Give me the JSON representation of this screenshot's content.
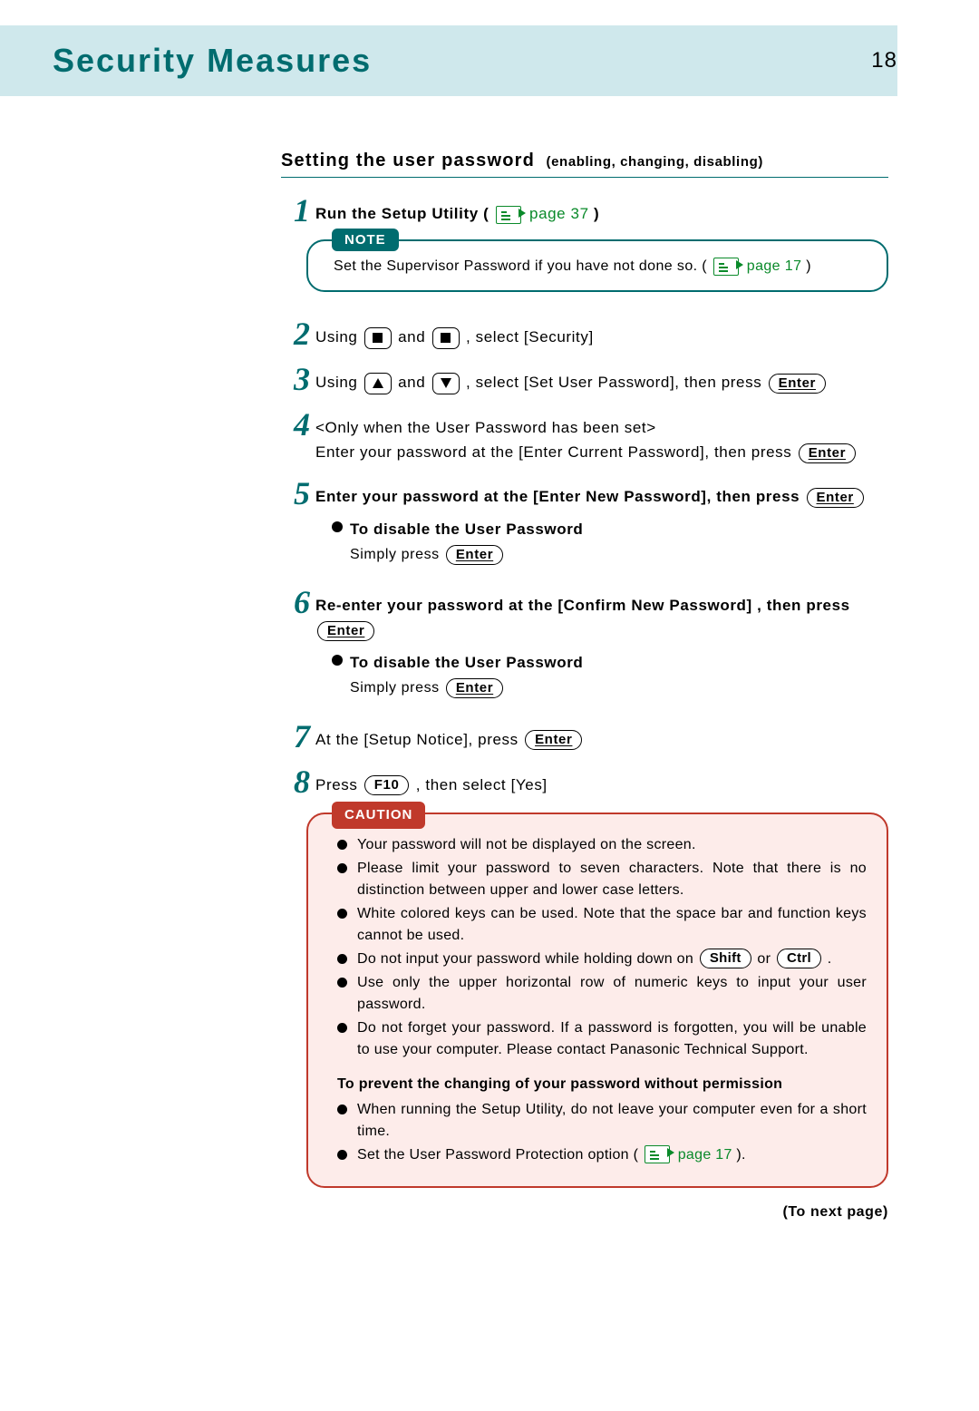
{
  "header": {
    "title": "Security Measures",
    "page_number": "18"
  },
  "section": {
    "title": "Setting the user password",
    "subtitle": "(enabling, changing, disabling)"
  },
  "steps": {
    "s1": {
      "num": "1",
      "text_a": "Run the Setup Utility  (",
      "page_ref": "page 37",
      "text_b": ")"
    },
    "note": {
      "label": "NOTE",
      "text_a": "Set the Supervisor Password if you have not done so. (",
      "page_ref": "page 17",
      "text_b": ")"
    },
    "s2": {
      "num": "2",
      "pre": "Using",
      "mid": "and",
      "post": ", select [Security]"
    },
    "s3": {
      "num": "3",
      "pre": "Using",
      "mid": "and",
      "post1": ", select [Set User Password], then press",
      "key": "Enter"
    },
    "s4": {
      "num": "4",
      "line1": "<Only when the User Password has been set>",
      "line2a": "Enter your password at the [Enter Current Password], then press",
      "key": "Enter"
    },
    "s5": {
      "num": "5",
      "line1a": "Enter your password at the [Enter New Password], then press",
      "key": "Enter",
      "disable_head": "To disable the User Password",
      "disable_text": "Simply press",
      "disable_key": "Enter"
    },
    "s6": {
      "num": "6",
      "line1a": "Re-enter your password at the [Confirm New Password] , then press",
      "key": "Enter",
      "disable_head": "To disable the User Password",
      "disable_text": "Simply press",
      "disable_key": "Enter"
    },
    "s7": {
      "num": "7",
      "text": "At the [Setup Notice], press",
      "key": "Enter"
    },
    "s8": {
      "num": "8",
      "text_a": "Press",
      "key": "F10",
      "text_b": ", then select [Yes]"
    }
  },
  "caution": {
    "label": "CAUTION",
    "items": [
      "Your password will not be displayed on the screen.",
      "Please limit your password to seven characters.  Note that there is no distinction between upper and lower case letters.",
      "White colored keys can be used.  Note that the space bar and function keys cannot be used."
    ],
    "item4_a": "Do not input your password while holding down on",
    "item4_shift": "Shift",
    "item4_or": "or",
    "item4_ctrl": "Ctrl",
    "item4_b": ".",
    "items2": [
      "Use only the upper horizontal row of numeric keys to input your user password.",
      "Do not forget your password.  If a password is forgotten, you will be unable to use your computer.  Please contact Panasonic Technical Support."
    ],
    "prevent_head": "To prevent the changing of your password without permission",
    "prevent_1": "When running the Setup Utility, do not leave your computer even for a short time.",
    "prevent_2a": "Set the User Password Protection option (",
    "prevent_page_ref": "page 17",
    "prevent_2b": ")."
  },
  "footer": {
    "to_next": "(To next page)"
  }
}
